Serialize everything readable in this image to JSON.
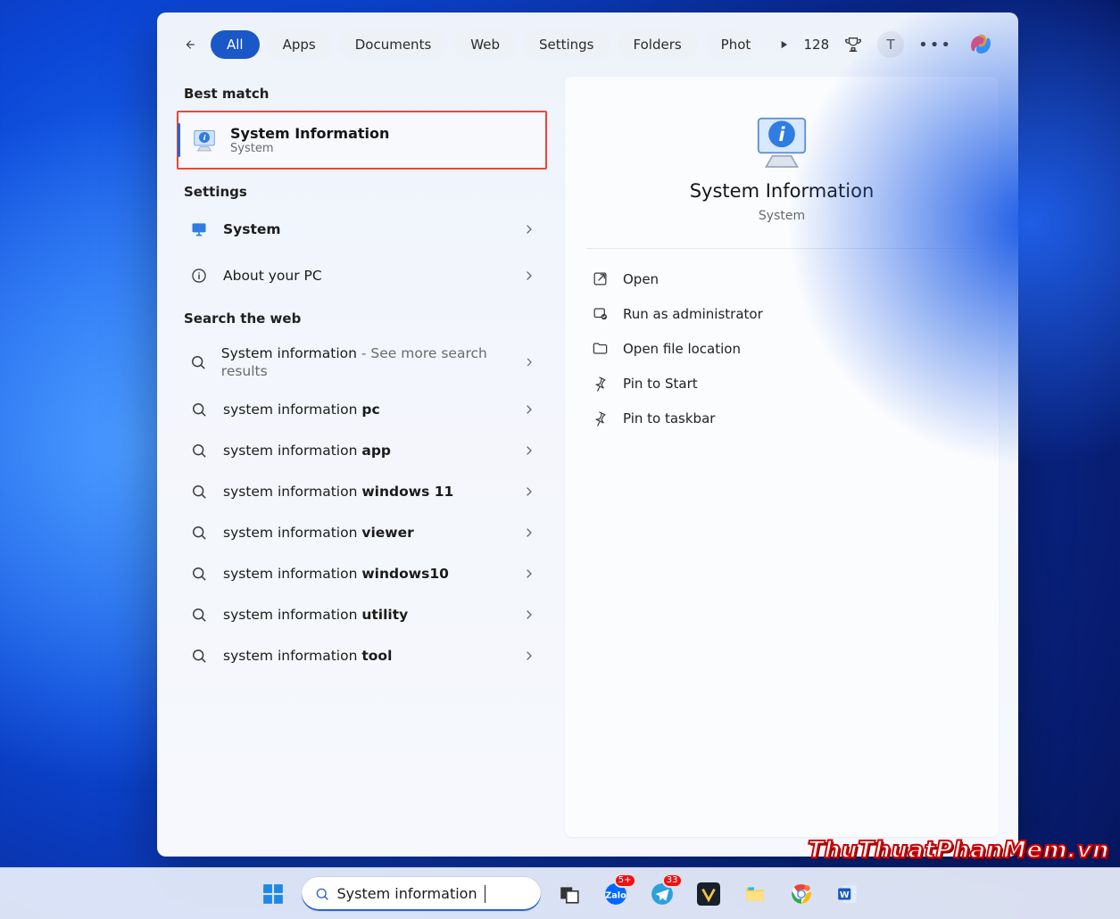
{
  "header": {
    "filters": [
      "All",
      "Apps",
      "Documents",
      "Web",
      "Settings",
      "Folders",
      "Phot"
    ],
    "active_filter": "All",
    "points": "128",
    "avatar_initial": "T"
  },
  "sections": {
    "best_match": "Best match",
    "settings": "Settings",
    "search_web": "Search the web"
  },
  "best_match": {
    "title": "System Information",
    "subtitle": "System"
  },
  "settings_results": [
    {
      "label": "System",
      "bold": "System",
      "icon": "monitor"
    },
    {
      "label": "About your PC",
      "bold": "",
      "icon": "info"
    }
  ],
  "web_results": [
    {
      "prefix": "System information",
      "suffix": " - See more search results",
      "bold": ""
    },
    {
      "prefix": "system information ",
      "suffix": "",
      "bold": "pc"
    },
    {
      "prefix": "system information ",
      "suffix": "",
      "bold": "app"
    },
    {
      "prefix": "system information ",
      "suffix": "",
      "bold": "windows 11"
    },
    {
      "prefix": "system information ",
      "suffix": "",
      "bold": "viewer"
    },
    {
      "prefix": "system information ",
      "suffix": "",
      "bold": "windows10"
    },
    {
      "prefix": "system information ",
      "suffix": "",
      "bold": "utility"
    },
    {
      "prefix": "system information ",
      "suffix": "",
      "bold": "tool"
    }
  ],
  "detail": {
    "title": "System Information",
    "subtitle": "System",
    "actions": [
      {
        "label": "Open",
        "icon": "open"
      },
      {
        "label": "Run as administrator",
        "icon": "admin"
      },
      {
        "label": "Open file location",
        "icon": "folder"
      },
      {
        "label": "Pin to Start",
        "icon": "pin"
      },
      {
        "label": "Pin to taskbar",
        "icon": "pin"
      }
    ]
  },
  "taskbar": {
    "search_text": "System information",
    "badges": {
      "zalo": "5+",
      "telegram": "33"
    }
  },
  "watermark": "ThuThuatPhanMem.vn"
}
